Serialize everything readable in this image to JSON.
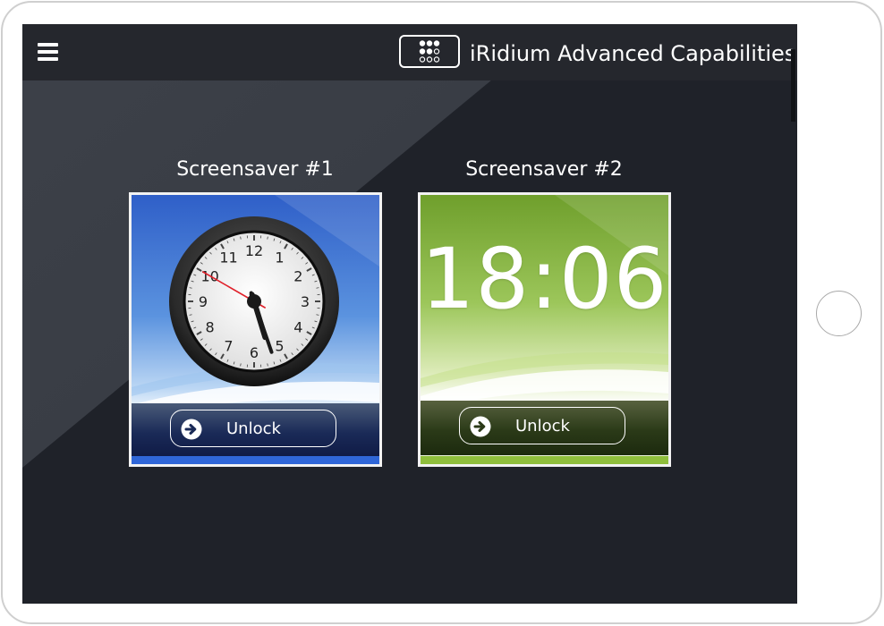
{
  "app": {
    "title": "iRidium Advanced Capabilities",
    "menu_icon": "hamburger-menu-icon",
    "logo_icon": "iridium-dot-grid-logo-icon"
  },
  "screensavers": [
    {
      "label": "Screensaver #1",
      "style": "analog-clock",
      "clock_numbers": [
        "12",
        "1",
        "2",
        "3",
        "4",
        "5",
        "6",
        "7",
        "8",
        "9",
        "10",
        "11"
      ],
      "time": {
        "hour": 5,
        "minute": 26,
        "second": 50
      },
      "unlock_label": "Unlock",
      "unlock_icon": "arrow-right-circle-icon",
      "accent": "#2f66d8"
    },
    {
      "label": "Screensaver #2",
      "display_time": "18:06",
      "style": "digital-clock",
      "unlock_label": "Unlock",
      "unlock_icon": "arrow-right-circle-icon",
      "accent": "#8fbe3c"
    }
  ],
  "colors": {
    "screen_background": "#1f2229",
    "topbar": "#25272d",
    "device_frame": "#cfcfcf",
    "card_border": "#f2f2f2"
  }
}
